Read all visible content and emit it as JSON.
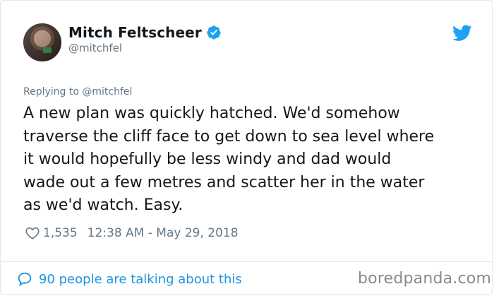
{
  "user": {
    "display_name": "Mitch Feltscheer",
    "handle": "@mitchfel",
    "verified": true
  },
  "reply": {
    "text": "Replying to @mitchfel"
  },
  "tweet": {
    "text": "A new plan was quickly hatched. We'd somehow\ntraverse the cliff face to get down to sea level where\nit would hopefully be less windy and dad would\nwade out a few metres and scatter her in the water\nas we'd watch. Easy."
  },
  "meta": {
    "likes": "1,535",
    "timestamp": "12:38 AM - May 29, 2018"
  },
  "footer": {
    "talking": "90 people are talking about this",
    "watermark": "boredpanda.com"
  },
  "colors": {
    "twitter_blue": "#1da1f2",
    "link_blue": "#1b95e0",
    "muted": "#657786"
  },
  "icons": [
    "avatar",
    "verified-badge-icon",
    "twitter-bird-icon",
    "heart-icon",
    "comment-bubble-icon"
  ]
}
